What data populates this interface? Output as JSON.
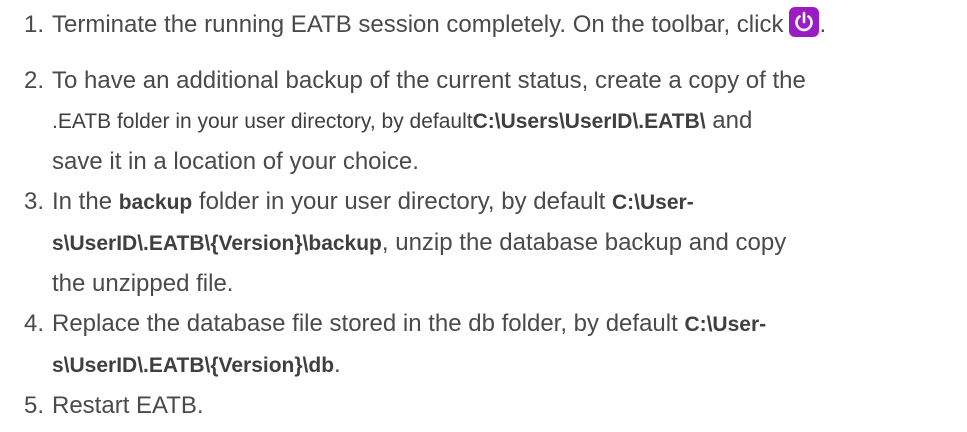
{
  "steps": [
    {
      "number": "1.",
      "text_before": "Terminate the running EATB session completely. On the toolbar, click",
      "text_after": ".",
      "icon": "power-icon"
    },
    {
      "number": "2.",
      "line1": "To have an additional backup of the current status, create a copy of the",
      "line2_before": ".EATB folder in your user directory, by default",
      "line2_code": "C:\\Users\\UserID\\.EATB\\",
      "line2_after": " and",
      "line3": "save it in a location of your choice."
    },
    {
      "number": "3.",
      "line1_before": "In the ",
      "line1_code1": "backup",
      "line1_mid": " folder in your user directory, by default ",
      "line1_code2": "C:\\User-",
      "line2_code": "s\\UserID\\.EATB\\{Version}\\backup",
      "line2_after": ", unzip the database backup and copy",
      "line3": "the unzipped file."
    },
    {
      "number": "4.",
      "line1_before": "Replace the database file stored in the db folder, by default ",
      "line1_code": "C:\\User-",
      "line2_code": "s\\UserID\\.EATB\\{Version}\\db",
      "line2_after": "."
    },
    {
      "number": "5.",
      "text": "Restart EATB."
    }
  ],
  "colors": {
    "text": "#4a4a4a",
    "icon_bg": "#9b1bc4"
  }
}
